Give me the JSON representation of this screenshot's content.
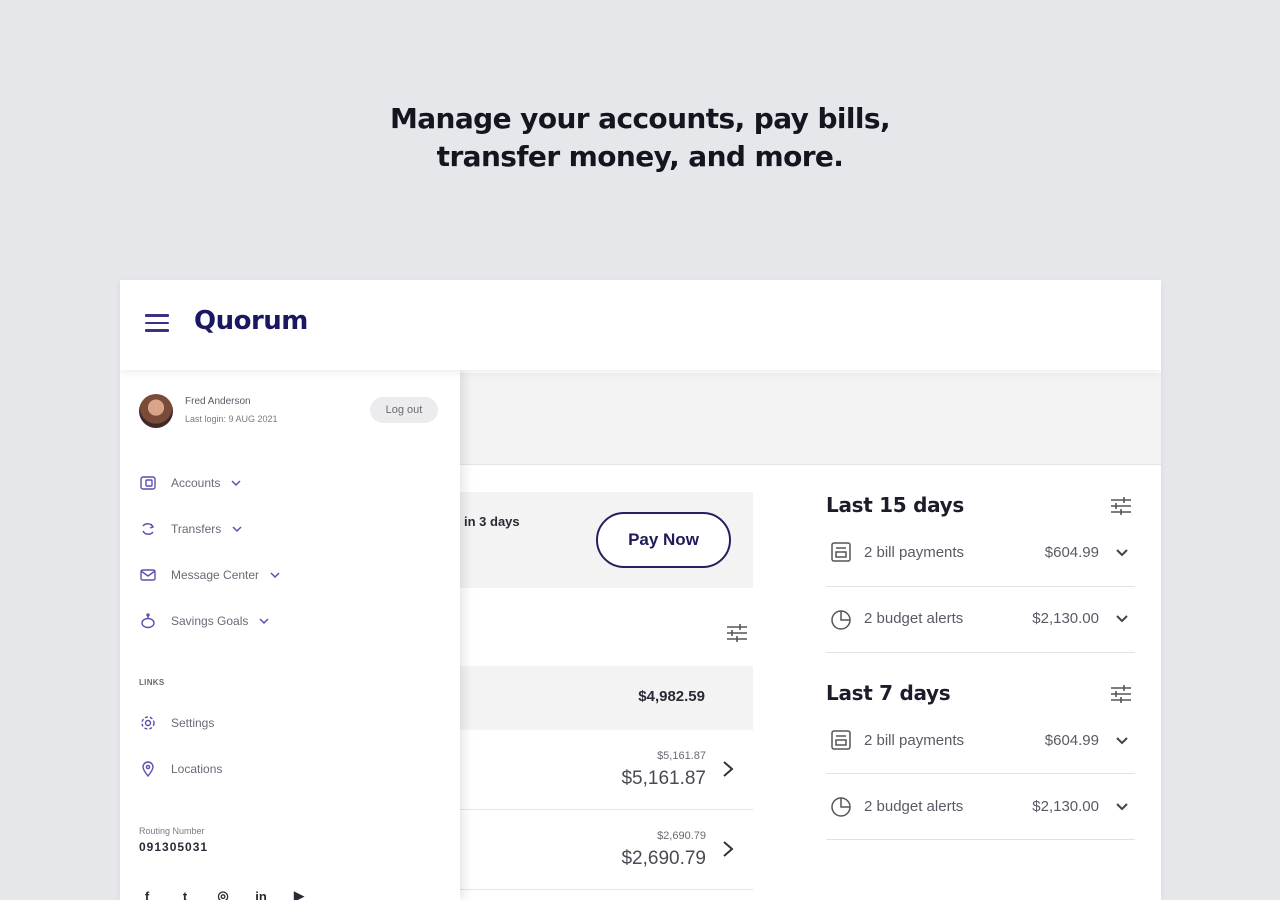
{
  "headline": {
    "line1": "Manage your accounts, pay bills,",
    "line2": "transfer money, and more."
  },
  "app": {
    "logo": "Quorum",
    "brand_color": "#1a1860",
    "accent_color": "#3b3286"
  },
  "drawer": {
    "user_name": "Fred Anderson",
    "last_login": "Last login: 9 AUG 2021",
    "logout_label": "Log out",
    "nav": [
      {
        "label": "Accounts",
        "icon": "accounts-icon"
      },
      {
        "label": "Transfers",
        "icon": "transfers-icon"
      },
      {
        "label": "Message Center",
        "icon": "message-icon"
      },
      {
        "label": "Savings Goals",
        "icon": "savings-icon"
      }
    ],
    "links_heading": "LINKS",
    "links": [
      {
        "label": "Settings",
        "icon": "gear-icon"
      },
      {
        "label": "Locations",
        "icon": "location-pin-icon"
      }
    ],
    "routing_label": "Routing Number",
    "routing_number": "091305031",
    "socials": [
      "facebook-icon",
      "twitter-icon",
      "instagram-icon",
      "linkedin-icon",
      "youtube-icon"
    ]
  },
  "main": {
    "bill_due": "in 3 days",
    "pay_now_label": "Pay Now",
    "total_balance": "$4,982.59",
    "accounts": [
      {
        "available": "$5,161.87",
        "balance": "$5,161.87"
      },
      {
        "available": "$2,690.79",
        "balance": "$2,690.79"
      }
    ]
  },
  "activity": {
    "sections": [
      {
        "title": "Last 15 days",
        "rows": [
          {
            "label": "2 bill payments",
            "amount": "$604.99",
            "icon": "bill-icon"
          },
          {
            "label": "2 budget alerts",
            "amount": "$2,130.00",
            "icon": "pie-chart-icon"
          }
        ]
      },
      {
        "title": "Last 7 days",
        "rows": [
          {
            "label": "2 bill payments",
            "amount": "$604.99",
            "icon": "bill-icon"
          },
          {
            "label": "2 budget alerts",
            "amount": "$2,130.00",
            "icon": "pie-chart-icon"
          }
        ]
      }
    ]
  }
}
